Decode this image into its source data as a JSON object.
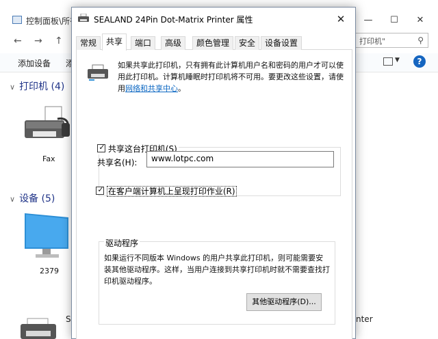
{
  "background_window": {
    "title": "控制面板\\所有",
    "search_placeholder": "打印机\"",
    "toolbar": {
      "add_device": "添加设备",
      "add_printer_partial": "添"
    },
    "groups": [
      {
        "label": "打印机 (4)"
      },
      {
        "label": "设备 (5)"
      }
    ],
    "devices": [
      {
        "label": "Fax"
      },
      {
        "label": "2379"
      }
    ],
    "bottom_left_partial": "S",
    "bottom_right_partial": "nter"
  },
  "dialog": {
    "title": "SEALAND 24Pin Dot-Matrix Printer 属性",
    "tabs": [
      {
        "label": "常规"
      },
      {
        "label": "共享"
      },
      {
        "label": "端口"
      },
      {
        "label": "高级"
      },
      {
        "label": "颜色管理"
      },
      {
        "label": "安全"
      },
      {
        "label": "设备设置"
      }
    ],
    "active_tab": "共享",
    "description": "如果共享此打印机，只有拥有此计算机用户名和密码的用户才可以使用此打印机。计算机睡眠时打印机将不可用。要更改这些设置，请使用",
    "description_link": "网络和共享中心",
    "description_end": "。",
    "share_checkbox": {
      "label": "共享这台打印机(S)",
      "checked": true
    },
    "share_name": {
      "label": "共享名(H):",
      "value": "www.lotpc.com"
    },
    "render_checkbox": {
      "label": "在客户端计算机上呈现打印作业(R)",
      "checked": true
    },
    "drivers": {
      "title": "驱动程序",
      "text": "如果运行不同版本 Windows 的用户共享此打印机，则可能需要安装其他驱动程序。这样，当用户连接到共享打印机时就不需要查找打印机驱动程序。",
      "button": "其他驱动程序(D)..."
    }
  },
  "colors": {
    "link": "#0a66c2",
    "group_header": "#1e3287",
    "help": "#1565c0"
  }
}
